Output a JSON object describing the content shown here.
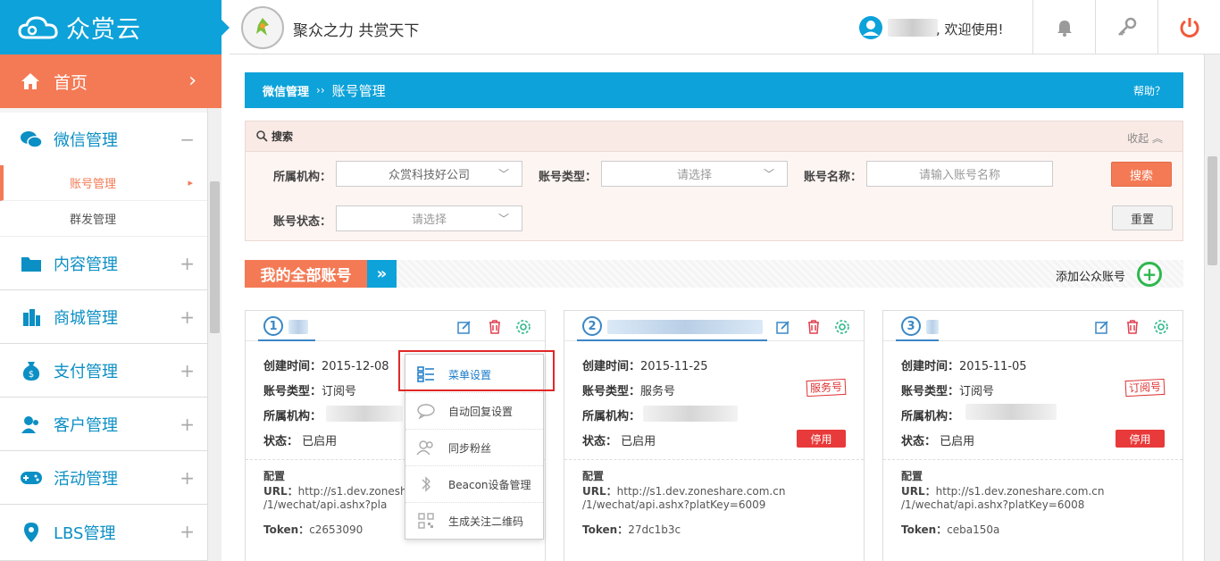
{
  "app": {
    "logo_text": "众赏云",
    "slogan": "聚众之力 共赏天下",
    "welcome": ", 欢迎使用!"
  },
  "sidebar": {
    "home": "首页",
    "items": [
      {
        "label": "微信管理",
        "sign": "−",
        "icon": "wechat-icon"
      },
      {
        "label": "内容管理",
        "sign": "+",
        "icon": "folder-icon"
      },
      {
        "label": "商城管理",
        "sign": "+",
        "icon": "building-icon"
      },
      {
        "label": "支付管理",
        "sign": "+",
        "icon": "money-bag-icon"
      },
      {
        "label": "客户管理",
        "sign": "+",
        "icon": "users-icon"
      },
      {
        "label": "活动管理",
        "sign": "+",
        "icon": "gamepad-icon"
      },
      {
        "label": "LBS管理",
        "sign": "+",
        "icon": "map-pin-icon"
      }
    ],
    "subitems": [
      {
        "label": "账号管理",
        "active": true
      },
      {
        "label": "群发管理",
        "active": false
      }
    ]
  },
  "breadcrumb": {
    "parent": "微信管理",
    "separator": "››",
    "current": "账号管理",
    "help": "帮助？"
  },
  "search": {
    "title": "搜索",
    "collapse": "收起",
    "org_label": "所属机构：",
    "org_value": "众赏科技好公司",
    "type_label": "账号类型：",
    "type_placeholder": "请选择",
    "name_label": "账号名称：",
    "name_placeholder": "请输入账号名称",
    "status_label": "账号状态：",
    "status_placeholder": "请选择",
    "search_btn": "搜索",
    "reset_btn": "重置"
  },
  "accounts": {
    "title": "我的全部账号",
    "arrow": "»",
    "add_label": "添加公众账号",
    "cards": [
      {
        "num": "1",
        "created_label": "创建时间：",
        "created": "2015-12-08",
        "type_label": "账号类型：",
        "type": "订阅号",
        "org_label": "所属机构：",
        "status_label": "状态：",
        "status": "已启用",
        "cfg_label": "配置",
        "url_label": "URL：",
        "url_l1": "http://s1.dev.zonesha",
        "url_l2": "/1/wechat/api.ashx?pla",
        "token_label": "Token：",
        "token": "c2653090"
      },
      {
        "num": "2",
        "created_label": "创建时间：",
        "created": "2015-11-25",
        "type_label": "账号类型：",
        "type": "服务号",
        "stamp": "服务号",
        "org_label": "所属机构：",
        "status_label": "状态：",
        "status": "已启用",
        "stop": "停用",
        "cfg_label": "配置",
        "url_label": "URL：",
        "url_l1": "http://s1.dev.zoneshare.com.cn",
        "url_l2": "/1/wechat/api.ashx?platKey=6009",
        "token_label": "Token：",
        "token": "27dc1b3c"
      },
      {
        "num": "3",
        "created_label": "创建时间：",
        "created": "2015-11-05",
        "type_label": "账号类型：",
        "type": "订阅号",
        "stamp": "订阅号",
        "org_label": "所属机构：",
        "status_label": "状态：",
        "status": "已启用",
        "stop": "停用",
        "cfg_label": "配置",
        "url_label": "URL：",
        "url_l1": "http://s1.dev.zoneshare.com.cn",
        "url_l2": "/1/wechat/api.ashx?platKey=6008",
        "token_label": "Token：",
        "token": "ceba150a"
      }
    ]
  },
  "settings_menu": [
    "菜单设置",
    "自动回复设置",
    "同步粉丝",
    "Beacon设备管理",
    "生成关注二维码"
  ],
  "colors": {
    "primary": "#0da2d9",
    "accent": "#f47a55",
    "danger": "#e83a3a",
    "success": "#2eb84f"
  }
}
